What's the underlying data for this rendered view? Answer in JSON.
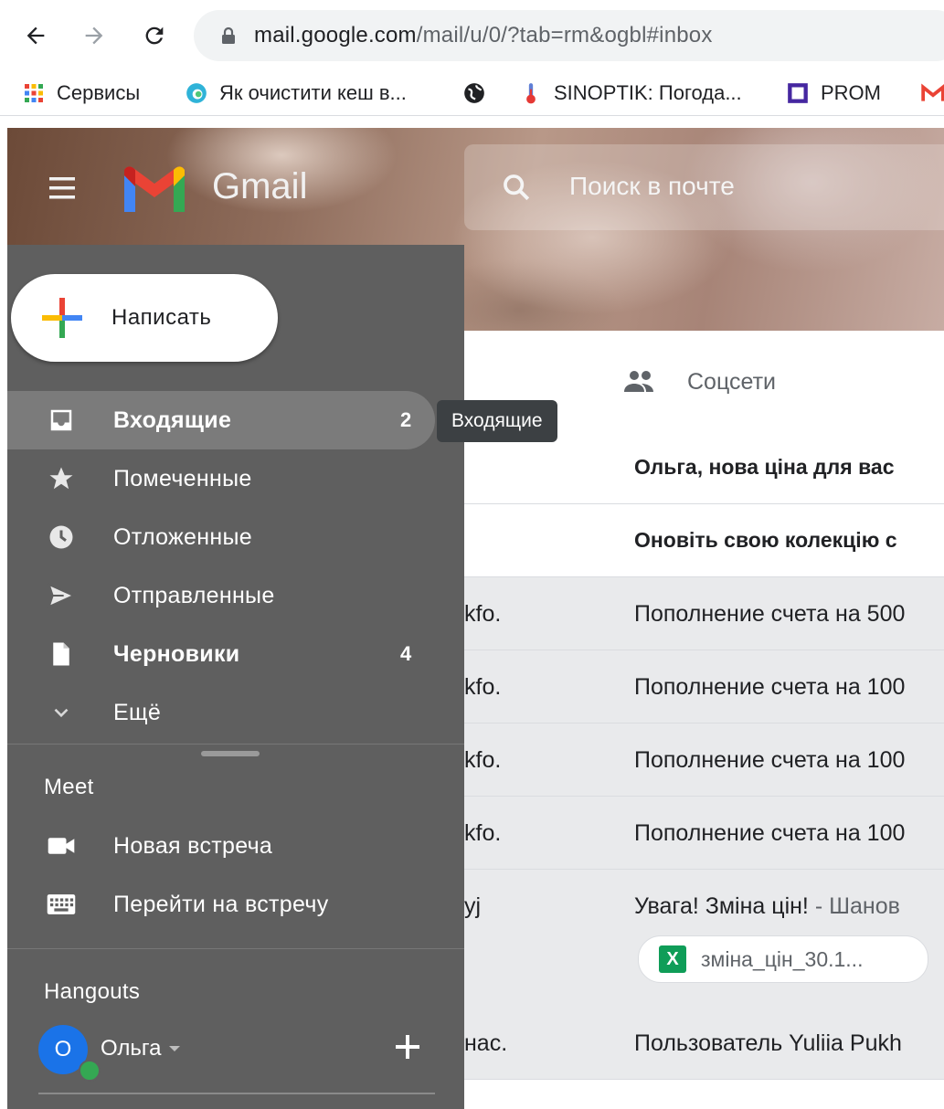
{
  "browser": {
    "url_host": "mail.google.com",
    "url_path": "/mail/u/0/?tab=rm&ogbl#inbox",
    "bookmarks": [
      {
        "label": "Сервисы",
        "icon": "apps-grid-icon"
      },
      {
        "label": "Як очистити кеш в...",
        "icon": "edge-swirl-icon"
      },
      {
        "label": "",
        "icon": "globe-icon"
      },
      {
        "label": "SINOPTIK: Погода...",
        "icon": "thermometer-icon"
      },
      {
        "label": "PROM",
        "icon": "prom-square-icon"
      }
    ]
  },
  "header": {
    "app_name": "Gmail",
    "search_placeholder": "Поиск в почте"
  },
  "sidebar": {
    "compose_label": "Написать",
    "items": [
      {
        "label": "Входящие",
        "count": "2",
        "icon": "inbox-icon",
        "bold": true,
        "active": true
      },
      {
        "label": "Помеченные",
        "count": "",
        "icon": "star-icon"
      },
      {
        "label": "Отложенные",
        "count": "",
        "icon": "clock-icon"
      },
      {
        "label": "Отправленные",
        "count": "",
        "icon": "send-icon"
      },
      {
        "label": "Черновики",
        "count": "4",
        "icon": "draft-icon",
        "bold": true
      },
      {
        "label": "Ещё",
        "count": "",
        "icon": "chevron-down-icon"
      }
    ],
    "tooltip": "Входящие",
    "meet": {
      "title": "Meet",
      "items": [
        {
          "label": "Новая встреча",
          "icon": "videocam-icon"
        },
        {
          "label": "Перейти на встречу",
          "icon": "keyboard-icon"
        }
      ]
    },
    "hangouts": {
      "title": "Hangouts",
      "avatar_letter": "О",
      "user_name": "Ольга"
    }
  },
  "mail_list": {
    "tab_label": "Соцсети",
    "rows": [
      {
        "sender": "",
        "subject": "Ольга, нова ціна для вас",
        "snippet": "",
        "bold": true,
        "read": false
      },
      {
        "sender": "",
        "subject": "Оновіть свою колекцію с",
        "snippet": "",
        "bold": true,
        "read": false
      },
      {
        "sender": "kfo.",
        "subject": "Пополнение счета на 500",
        "snippet": "",
        "bold": false,
        "read": true
      },
      {
        "sender": "kfo.",
        "subject": "Пополнение счета на 100",
        "snippet": "",
        "bold": false,
        "read": true
      },
      {
        "sender": "kfo.",
        "subject": "Пополнение счета на 100",
        "snippet": "",
        "bold": false,
        "read": true
      },
      {
        "sender": "kfo.",
        "subject": "Пополнение счета на 100",
        "snippet": "",
        "bold": false,
        "read": true
      },
      {
        "sender": "yj",
        "subject": "Увага! Зміна цін!",
        "snippet": " - Шанов",
        "bold": false,
        "read": true,
        "attachment": "зміна_цін_30.1..."
      },
      {
        "sender": "нас.",
        "subject": "Пользователь Yuliia Pukh",
        "snippet": "",
        "bold": false,
        "read": true
      }
    ]
  }
}
